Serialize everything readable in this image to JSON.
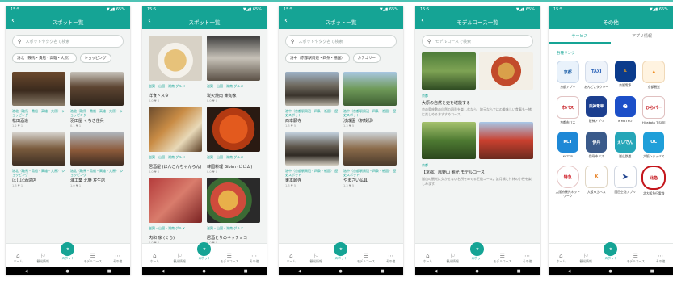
{
  "status": {
    "time": "15:5",
    "icons": "▼◢▮ 65%"
  },
  "screen1": {
    "title": "スポット一覧",
    "search_placeholder": "スポットやタグ名で検索",
    "filters": [
      "洛北（鞍馬・貴船・高雄・大原）",
      "ショッピング"
    ],
    "cards": [
      {
        "tag": "洛北（鞍馬・貴船・高雄・大原） ショッピング",
        "name": "松田酒造",
        "meta": "1.2 ♥ 1"
      },
      {
        "tag": "洛北（鞍馬・貴船・高雄・大原） ショッピング",
        "name": "羽田屋 くちき住兵",
        "meta": "0.1 ♥ 1"
      },
      {
        "tag": "洛北（鞍馬・貴船・高雄・大原） ショッピング",
        "name": "はしば酒造店",
        "meta": "1.3 ♥ 1"
      },
      {
        "tag": "洛北（鞍馬・貴船・高雄・大原） ショッピング",
        "name": "浦工業 北野 芹生店",
        "meta": "1.0 ♥ 1"
      }
    ]
  },
  "screen2": {
    "title": "スポット一覧",
    "cards": [
      {
        "tag": "滋賀・山国・湖南 グルメ",
        "name": "洋食ドスタ",
        "meta": "0.0 ♥ 0"
      },
      {
        "tag": "滋賀・山国・湖南 グルメ",
        "name": "炭火焼肉 楽旬家",
        "meta": "0.0 ♥ 0"
      },
      {
        "tag": "滋賀・山国・湖南 グルメ",
        "name": "居酒屋 (ほんこんちゃんろん)",
        "meta": "0.0 ♥ 0"
      },
      {
        "tag": "滋賀・山国・湖南 グルメ",
        "name": "韓国料理 Bibim (ビビム)",
        "meta": "0.0 ♥ 0"
      },
      {
        "tag": "滋賀・山国・湖南 グルメ",
        "name": "肉和 家 (くら)",
        "meta": "0.0 ♥ 0"
      },
      {
        "tag": "滋賀・山国・湖南 グルメ",
        "name": "居酒とりのキッチョコ",
        "meta": "0.0 ♥ 0"
      }
    ]
  },
  "screen3": {
    "title": "スポット一覧",
    "search_placeholder": "スポットやタグ名で検索",
    "filters": [
      "洛中（京都駅周辺・四条・祇園）",
      "カテゴリー"
    ],
    "cards": [
      {
        "tag": "洛中（京都駅周辺・四条・祇園） 歴史スポット",
        "name": "西本願寺",
        "meta": "1.3 ♥ 5"
      },
      {
        "tag": "洛中（京都駅周辺・四条・祇園） 歴史スポット",
        "name": "渉成園（枳殻邸）",
        "meta": "1.3 ♥ 5"
      },
      {
        "tag": "洛中（京都駅周辺・四条・祇園） 歴史スポット",
        "name": "東本願寺",
        "meta": "1.3 ♥ 5"
      },
      {
        "tag": "洛中（京都駅周辺・四条・祇園） 歴史スポット",
        "name": "やまざい仏具",
        "meta": "1.3 ♥ 5"
      }
    ]
  },
  "screen4": {
    "title": "モデルコース一覧",
    "search_placeholder": "モデルコースで検索",
    "course1": {
      "tag": "京都",
      "title": "大原の自然と史を堪能する",
      "desc": "京の奥座敷の自然の四季を楽しむなら、地元ならではの美味しい食事も一緒に楽しめるおすすめコース。"
    },
    "course2": {
      "tag": "京都",
      "title": "【京都】嵐野山 観光 モデルコース",
      "desc": "嵐山の観光に欠かせない名所をめぐる王道コース。渡月橋と竹林の小径を楽しみます。"
    }
  },
  "screen5": {
    "title": "その他",
    "tabs": [
      "サービス",
      "アプリ情報"
    ],
    "section": "各種リンク",
    "apps": [
      {
        "label": "京都アプリ",
        "text": "京都"
      },
      {
        "label": "あんどこタクシー",
        "text": "TAXI"
      },
      {
        "label": "京阪電車",
        "text": "K"
      },
      {
        "label": "京都観光",
        "text": "▲"
      },
      {
        "label": "京都市バス",
        "text": "市バス"
      },
      {
        "label": "阪神アプリ",
        "text": "阪神電車"
      },
      {
        "label": "e METRO",
        "text": "e"
      },
      {
        "label": "Hirakata T-SITE",
        "text": "ひらパー"
      },
      {
        "label": "KCTTP",
        "text": "KCT"
      },
      {
        "label": "伊丹市バス",
        "text": "伊丹"
      },
      {
        "label": "嵐山鉄道",
        "text": "えいでん"
      },
      {
        "label": "大阪シティバス",
        "text": "ОС"
      },
      {
        "label": "大阪府観光ネットワーク",
        "text": "特急"
      },
      {
        "label": "大阪市上バス",
        "text": "K"
      },
      {
        "label": "関西空港アプリ",
        "text": "➤"
      },
      {
        "label": "北大阪急行電鉄",
        "text": "北急"
      }
    ]
  },
  "nav": {
    "items": [
      "ホーム",
      "観光情報",
      "スポット",
      "モデルコース",
      "その他"
    ],
    "sys": [
      "◀",
      "●",
      "■"
    ]
  }
}
